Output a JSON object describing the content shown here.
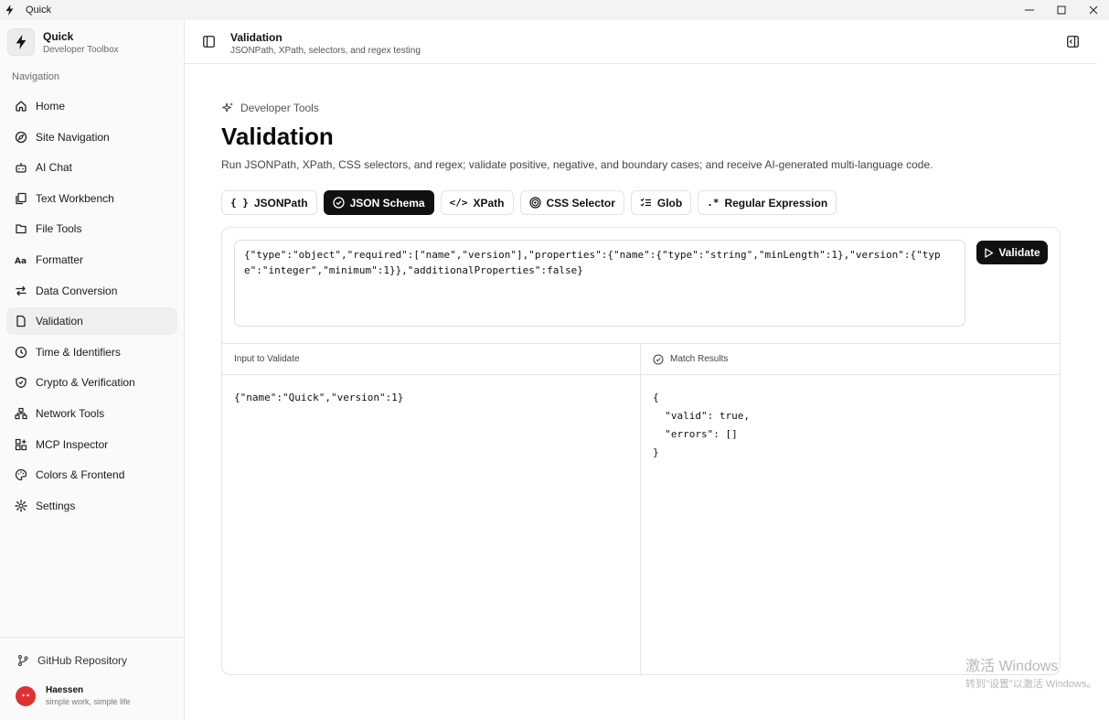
{
  "window": {
    "title": "Quick"
  },
  "brand": {
    "name": "Quick",
    "subtitle": "Developer Toolbox"
  },
  "sidebar": {
    "heading": "Navigation",
    "items": [
      {
        "label": "Home",
        "icon": "home-icon"
      },
      {
        "label": "Site Navigation",
        "icon": "compass-icon"
      },
      {
        "label": "AI Chat",
        "icon": "bot-icon"
      },
      {
        "label": "Text Workbench",
        "icon": "files-icon"
      },
      {
        "label": "File Tools",
        "icon": "folder-icon"
      },
      {
        "label": "Formatter",
        "icon": "type-icon"
      },
      {
        "label": "Data Conversion",
        "icon": "arrows-icon"
      },
      {
        "label": "Validation",
        "icon": "file-check-icon",
        "active": true
      },
      {
        "label": "Time & Identifiers",
        "icon": "clock-icon"
      },
      {
        "label": "Crypto & Verification",
        "icon": "shield-icon"
      },
      {
        "label": "Network Tools",
        "icon": "network-icon"
      },
      {
        "label": "MCP Inspector",
        "icon": "mcp-icon"
      },
      {
        "label": "Colors & Frontend",
        "icon": "palette-icon"
      },
      {
        "label": "Settings",
        "icon": "gear-icon"
      }
    ],
    "github": "GitHub Repository",
    "user": {
      "name": "Haessen",
      "tagline": "simple work, simple life"
    }
  },
  "header": {
    "title": "Validation",
    "subtitle": "JSONPath, XPath, selectors, and regex testing"
  },
  "page": {
    "kicker": "Developer Tools",
    "title": "Validation",
    "description": "Run JSONPath, XPath, CSS selectors, and regex; validate positive, negative, and boundary cases; and receive AI-generated multi-language code."
  },
  "tabs": [
    {
      "label": "JSONPath",
      "glyph": "{ }"
    },
    {
      "label": "JSON Schema",
      "active": true
    },
    {
      "label": "XPath",
      "glyph": "</>"
    },
    {
      "label": "CSS Selector"
    },
    {
      "label": "Glob"
    },
    {
      "label": "Regular Expression",
      "glyph": ".*"
    }
  ],
  "editor": {
    "schema": "{\"type\":\"object\",\"required\":[\"name\",\"version\"],\"properties\":{\"name\":{\"type\":\"string\",\"minLength\":1},\"version\":{\"type\":\"integer\",\"minimum\":1}},\"additionalProperties\":false}",
    "validate_label": "Validate"
  },
  "input_pane": {
    "title": "Input to Validate",
    "value": "{\"name\":\"Quick\",\"version\":1}"
  },
  "results_pane": {
    "title": "Match Results",
    "value": "{\n  \"valid\": true,\n  \"errors\": []\n}"
  },
  "watermark": {
    "line1": "激活 Windows",
    "line2": "转到\"设置\"以激活 Windows。"
  },
  "colors": {
    "accent": "#111111",
    "avatar": "#e03131",
    "sidebar_bg": "#fafafa"
  }
}
